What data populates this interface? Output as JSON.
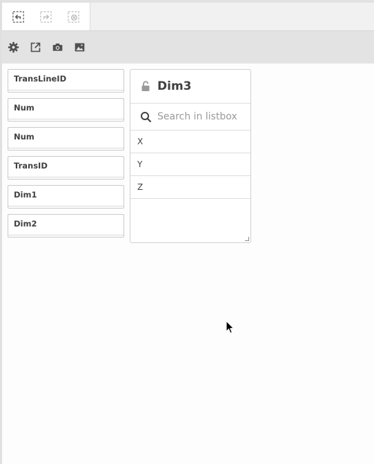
{
  "selection_toolbar": {
    "buttons": [
      {
        "icon": "step-back-icon",
        "enabled": true
      },
      {
        "icon": "step-forward-icon",
        "enabled": false
      },
      {
        "icon": "clear-selections-icon",
        "enabled": false
      }
    ]
  },
  "tool_row": {
    "icons": [
      "gear-icon",
      "external-link-icon",
      "camera-icon",
      "image-icon"
    ]
  },
  "fields": [
    {
      "label": "TransLineID"
    },
    {
      "label": "Num"
    },
    {
      "label": "Num"
    },
    {
      "label": "TransID"
    },
    {
      "label": "Dim1"
    },
    {
      "label": "Dim2"
    }
  ],
  "listbox": {
    "title": "Dim3",
    "lock_state": "unlocked",
    "search_placeholder": "Search in listbox",
    "items": [
      "X",
      "Y",
      "Z"
    ]
  },
  "colors": {
    "toolbar_bg": "#f1f1f1",
    "toolrow_bg": "#e3e3e3",
    "text": "#404040",
    "border": "#cfcfcf"
  }
}
